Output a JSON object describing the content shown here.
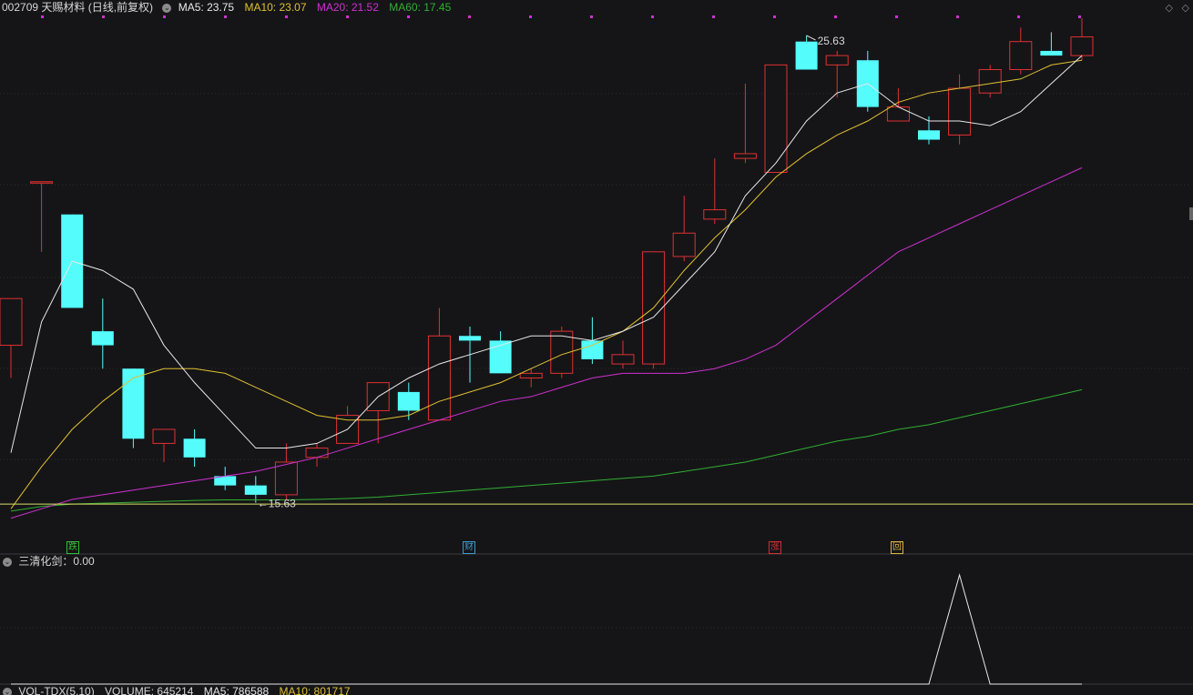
{
  "header": {
    "symbol": "002709 天赐材料 (日线,前复权)",
    "indicators": [
      {
        "label": "MA5: 23.75",
        "color": "#e8e8e8"
      },
      {
        "label": "MA10: 23.07",
        "color": "#e0c030"
      },
      {
        "label": "MA20: 21.52",
        "color": "#d030d0"
      },
      {
        "label": "MA60: 17.45",
        "color": "#30b030"
      }
    ]
  },
  "sub_indicator": {
    "label": "三清化剑：0.00"
  },
  "volume": {
    "name": "VOL-TDX(5,10)",
    "volume": "VOLUME: 645214",
    "ma5": "MA5: 786588",
    "ma10": "MA10: 801717"
  },
  "markers": [
    {
      "text": "跌",
      "color": "#30c030"
    },
    {
      "text": "财",
      "color": "#3a9ad0"
    },
    {
      "text": "涨",
      "color": "#d03030"
    },
    {
      "text": "回",
      "color": "#e0b040"
    }
  ],
  "annotations": {
    "high": "25.63",
    "low": "15.63"
  },
  "colors": {
    "up": "#e03030",
    "down": "#54fcfc",
    "background": "#151518"
  },
  "chart_data": {
    "type": "candlestick",
    "title": "002709 天赐材料 (日线,前复权)",
    "candles": [
      {
        "o": 19.0,
        "h": 20.0,
        "l": 18.3,
        "c": 20.0
      },
      {
        "o": 22.5,
        "h": 22.5,
        "l": 21.0,
        "c": 22.5
      },
      {
        "o": 21.8,
        "h": 21.8,
        "l": 19.8,
        "c": 19.8
      },
      {
        "o": 19.3,
        "h": 20.0,
        "l": 18.5,
        "c": 19.0
      },
      {
        "o": 18.5,
        "h": 18.5,
        "l": 16.8,
        "c": 17.0
      },
      {
        "o": 16.9,
        "h": 17.2,
        "l": 16.5,
        "c": 17.2
      },
      {
        "o": 17.0,
        "h": 17.2,
        "l": 16.4,
        "c": 16.6
      },
      {
        "o": 16.2,
        "h": 16.4,
        "l": 15.9,
        "c": 16.0
      },
      {
        "o": 16.0,
        "h": 16.2,
        "l": 15.63,
        "c": 15.8
      },
      {
        "o": 15.8,
        "h": 16.9,
        "l": 15.7,
        "c": 16.5
      },
      {
        "o": 16.6,
        "h": 16.9,
        "l": 16.4,
        "c": 16.8
      },
      {
        "o": 16.9,
        "h": 17.7,
        "l": 16.9,
        "c": 17.5
      },
      {
        "o": 17.6,
        "h": 18.0,
        "l": 16.9,
        "c": 18.2
      },
      {
        "o": 18.0,
        "h": 18.2,
        "l": 17.4,
        "c": 17.6
      },
      {
        "o": 17.4,
        "h": 19.8,
        "l": 17.4,
        "c": 19.2
      },
      {
        "o": 19.2,
        "h": 19.4,
        "l": 18.2,
        "c": 19.1
      },
      {
        "o": 19.1,
        "h": 19.3,
        "l": 18.4,
        "c": 18.4
      },
      {
        "o": 18.3,
        "h": 18.5,
        "l": 18.1,
        "c": 18.4
      },
      {
        "o": 18.4,
        "h": 19.4,
        "l": 18.3,
        "c": 19.3
      },
      {
        "o": 19.1,
        "h": 19.6,
        "l": 18.6,
        "c": 18.7
      },
      {
        "o": 18.6,
        "h": 19.1,
        "l": 18.5,
        "c": 18.8
      },
      {
        "o": 18.6,
        "h": 21.0,
        "l": 18.5,
        "c": 21.0
      },
      {
        "o": 20.9,
        "h": 22.2,
        "l": 20.8,
        "c": 21.4
      },
      {
        "o": 21.7,
        "h": 23.0,
        "l": 21.6,
        "c": 21.9
      },
      {
        "o": 23.0,
        "h": 24.6,
        "l": 22.9,
        "c": 23.1
      },
      {
        "o": 22.7,
        "h": 25.0,
        "l": 22.7,
        "c": 25.0
      },
      {
        "o": 25.5,
        "h": 25.63,
        "l": 24.9,
        "c": 24.9
      },
      {
        "o": 25.0,
        "h": 25.3,
        "l": 24.3,
        "c": 25.2
      },
      {
        "o": 25.1,
        "h": 25.3,
        "l": 24.0,
        "c": 24.1
      },
      {
        "o": 23.8,
        "h": 24.5,
        "l": 23.8,
        "c": 24.1
      },
      {
        "o": 23.6,
        "h": 23.9,
        "l": 23.3,
        "c": 23.4
      },
      {
        "o": 23.5,
        "h": 24.8,
        "l": 23.3,
        "c": 24.5
      },
      {
        "o": 24.4,
        "h": 25.0,
        "l": 24.3,
        "c": 24.9
      },
      {
        "o": 24.9,
        "h": 25.8,
        "l": 24.8,
        "c": 25.5
      },
      {
        "o": 25.3,
        "h": 25.7,
        "l": 25.2,
        "c": 25.2
      },
      {
        "o": 25.2,
        "h": 26.0,
        "l": 25.1,
        "c": 25.6
      }
    ],
    "ma5": [
      16.7,
      19.5,
      20.8,
      20.6,
      20.2,
      19.0,
      18.2,
      17.5,
      16.8,
      16.8,
      16.9,
      17.2,
      17.9,
      18.3,
      18.6,
      18.8,
      19.0,
      19.2,
      19.2,
      19.1,
      19.3,
      19.6,
      20.3,
      21.0,
      22.2,
      22.9,
      23.8,
      24.4,
      24.6,
      24.1,
      23.8,
      23.8,
      23.7,
      24.0,
      24.6,
      25.2
    ],
    "ma10": [
      15.5,
      16.4,
      17.2,
      17.8,
      18.3,
      18.5,
      18.5,
      18.4,
      18.1,
      17.8,
      17.5,
      17.4,
      17.4,
      17.5,
      17.8,
      18.0,
      18.2,
      18.5,
      18.8,
      19.0,
      19.3,
      19.8,
      20.6,
      21.3,
      21.9,
      22.6,
      23.1,
      23.5,
      23.8,
      24.2,
      24.4,
      24.5,
      24.6,
      24.7,
      25.0,
      25.1
    ],
    "ma20": [
      15.3,
      15.5,
      15.7,
      15.8,
      15.9,
      16.0,
      16.1,
      16.2,
      16.3,
      16.45,
      16.6,
      16.8,
      17.0,
      17.2,
      17.4,
      17.6,
      17.8,
      17.9,
      18.1,
      18.3,
      18.4,
      18.4,
      18.4,
      18.5,
      18.7,
      19.0,
      19.5,
      20.0,
      20.5,
      21.0,
      21.3,
      21.6,
      21.9,
      22.2,
      22.5,
      22.8
    ],
    "ma60": [
      15.45,
      15.55,
      15.6,
      15.62,
      15.64,
      15.66,
      15.68,
      15.69,
      15.69,
      15.69,
      15.7,
      15.72,
      15.75,
      15.8,
      15.85,
      15.9,
      15.95,
      16.0,
      16.05,
      16.1,
      16.15,
      16.2,
      16.3,
      16.4,
      16.5,
      16.65,
      16.8,
      16.95,
      17.05,
      17.2,
      17.3,
      17.45,
      17.6,
      17.75,
      17.9,
      18.05
    ],
    "flat_line": 15.6,
    "sub_line": [
      0,
      0,
      0,
      0,
      0,
      0,
      0,
      0,
      0,
      0,
      0,
      0,
      0,
      0,
      0,
      0,
      0,
      0,
      0,
      0,
      0,
      0,
      0,
      0,
      0,
      0,
      0,
      0,
      0,
      0,
      0,
      1,
      0,
      0,
      0,
      0
    ],
    "ylim": [
      15.0,
      26.0
    ]
  }
}
